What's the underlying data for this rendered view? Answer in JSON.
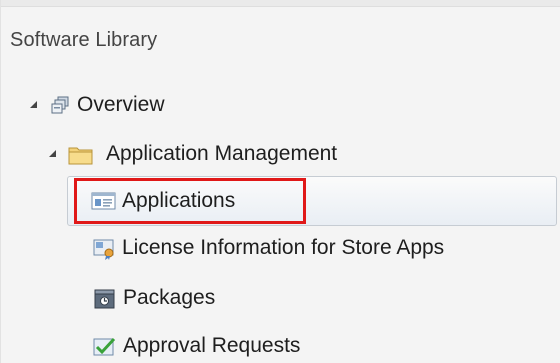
{
  "panel": {
    "title": "Software Library"
  },
  "tree": {
    "overview": {
      "label": "Overview",
      "icon": "overview-icon",
      "expanded": true
    },
    "app_management": {
      "label": "Application Management",
      "icon": "folder-icon",
      "expanded": true
    },
    "children": [
      {
        "label": "Applications",
        "icon": "applications-icon",
        "selected": true
      },
      {
        "label": "License Information for Store Apps",
        "icon": "license-icon"
      },
      {
        "label": "Packages",
        "icon": "packages-icon"
      },
      {
        "label": "Approval Requests",
        "icon": "approval-icon"
      }
    ]
  },
  "colors": {
    "highlight": "#e01818",
    "selection_border": "#c6ccd3",
    "folder": "#f0c85a"
  }
}
